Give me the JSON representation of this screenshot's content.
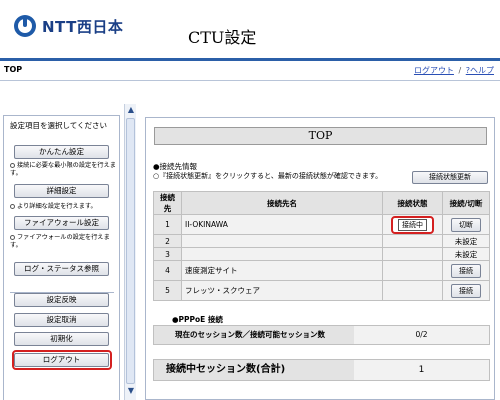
{
  "header": {
    "logo_text": "NTT西日本",
    "app_title": "CTU設定"
  },
  "topbar": {
    "title": "TOP",
    "logout_link": "ログアウト",
    "separator": "/",
    "help_link": "?ヘルプ"
  },
  "sidebar": {
    "heading": "設定項目を選択してください",
    "buttons": {
      "easy": "かんたん設定",
      "detail": "詳細設定",
      "firewall": "ファイアウォール設定",
      "log": "ログ・ステータス参照",
      "apply": "設定反映",
      "cancel": "設定取消",
      "init": "初期化",
      "logout": "ログアウト"
    },
    "notes": {
      "easy": "接続に必要な最小限の設定を行えます。",
      "detail": "より詳細な設定を行えます。",
      "firewall": "ファイアウォールの設定を行えます。"
    }
  },
  "main": {
    "title": "TOP",
    "conn_section": "●接続先情報",
    "conn_note": "○『接続状態更新』をクリックすると、最新の接続状態が確認できます。",
    "refresh_button": "接続状態更新",
    "table": {
      "headers": [
        "接続先",
        "接続先名",
        "接続状態",
        "接続/切断"
      ],
      "rows": [
        {
          "num": "1",
          "name": "II-OKINAWA",
          "status": "接続中",
          "action": "切断"
        },
        {
          "num": "2",
          "name": "",
          "status": "",
          "action": "未設定"
        },
        {
          "num": "3",
          "name": "",
          "status": "",
          "action": "未設定"
        },
        {
          "num": "4",
          "name": "速度測定サイト",
          "status": "",
          "action": "接続"
        },
        {
          "num": "5",
          "name": "フレッツ・スクウェア",
          "status": "",
          "action": "接続"
        }
      ]
    },
    "pppoe": {
      "label": "●PPPoE 接続",
      "row_label": "現在のセッション数／接続可能セッション数",
      "row_value": "0/2"
    },
    "total": {
      "label": "接続中セッション数(合計)",
      "value": "1"
    }
  }
}
